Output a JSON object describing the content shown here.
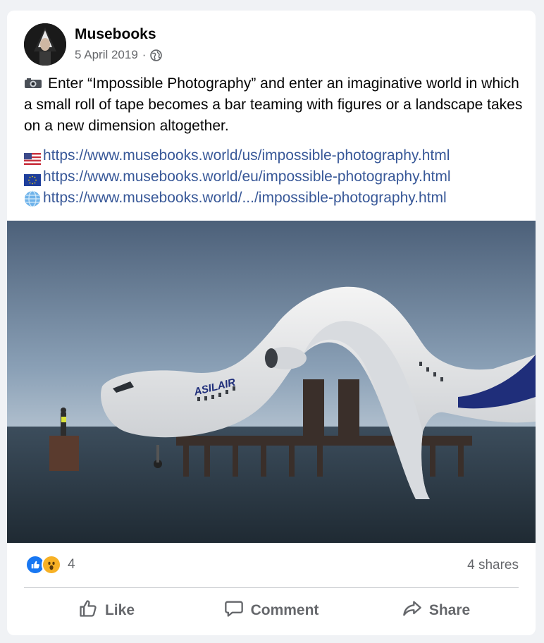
{
  "post": {
    "author": "Musebooks",
    "date": "5 April 2019",
    "date_sep": "·",
    "privacy_icon": "globe-icon",
    "text_icon": "camera-icon",
    "text": "Enter “Impossible Photography” and enter an imaginative world in which a small roll of tape becomes a bar teaming with figures or a landscape takes on a new dimension altogether.",
    "links": [
      {
        "flag": "us-flag-icon",
        "url": "https://www.musebooks.world/us/impossible-photography.html"
      },
      {
        "flag": "eu-flag-icon",
        "url": "https://www.musebooks.world/eu/impossible-photography.html"
      },
      {
        "flag": "globe-icon",
        "url": "https://www.musebooks.world/.../impossible-photography.html"
      }
    ],
    "photo": {
      "fuselage_text": "ASILAIR"
    }
  },
  "engagement": {
    "reaction_icons": [
      "like-reaction-icon",
      "wow-reaction-icon"
    ],
    "reaction_count": "4",
    "shares": "4 shares"
  },
  "actions": {
    "like": "Like",
    "comment": "Comment",
    "share": "Share"
  },
  "colors": {
    "link": "#385898",
    "secondary_text": "#65676b",
    "like_blue": "#1877f2",
    "background": "#f0f2f5"
  }
}
